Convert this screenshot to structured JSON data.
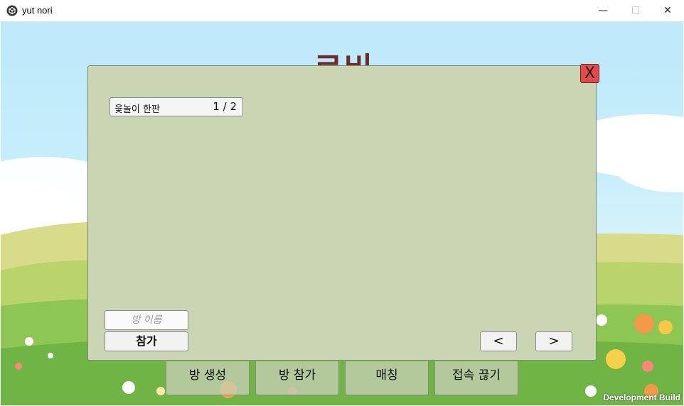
{
  "window": {
    "title": "yut nori",
    "minimize": "—",
    "maximize": "☐",
    "close": "✕"
  },
  "background": {
    "title": "로비"
  },
  "panel": {
    "close_label": "X",
    "rooms": [
      {
        "name": "윷놀이 한판",
        "count": "1 / 2"
      }
    ],
    "name_input_placeholder": "방 이름",
    "join_label": "참가",
    "prev_label": "<",
    "next_label": ">"
  },
  "menu": {
    "create_room": "방 생성",
    "join_room": "방 참가",
    "matching": "매칭",
    "disconnect": "접속 끊기"
  },
  "footer": {
    "build_label": "Development Build"
  },
  "colors": {
    "panel": "#c9d5b3",
    "close_button": "#e24b4b",
    "sky": "#bde9fb"
  },
  "icons": {
    "app": "unity-cube-icon"
  }
}
